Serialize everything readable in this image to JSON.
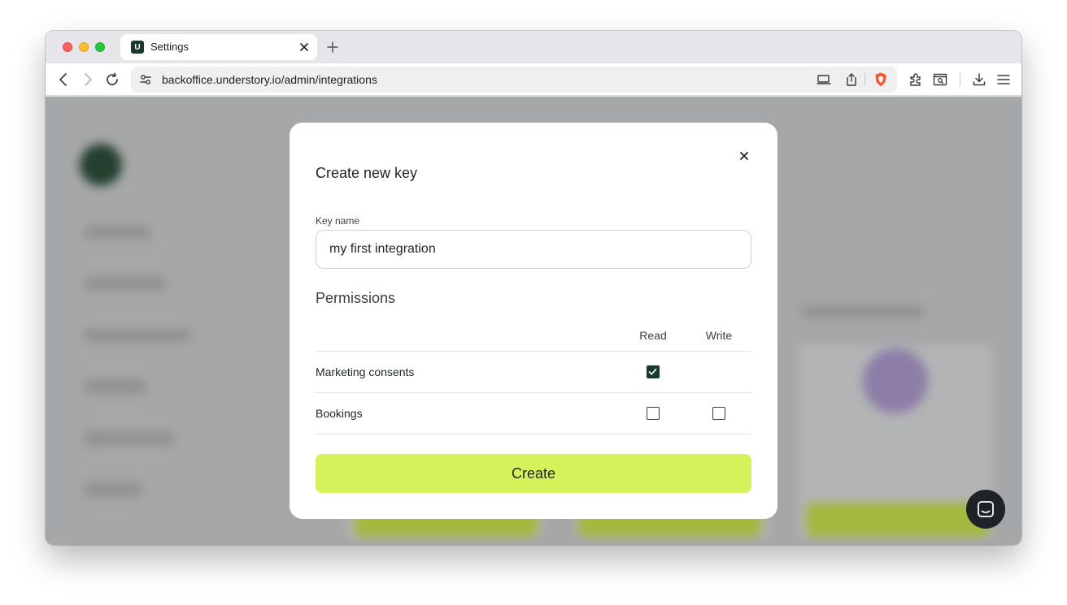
{
  "browser": {
    "tab_title": "Settings",
    "tab_favicon_letter": "U",
    "url": "backoffice.understory.io/admin/integrations",
    "accent_colors": {
      "brave": "#fb542b"
    }
  },
  "modal": {
    "title": "Create new key",
    "key_name_label": "Key name",
    "key_name_value": "my first integration",
    "permissions_title": "Permissions",
    "columns": {
      "read": "Read",
      "write": "Write"
    },
    "rows": [
      {
        "label": "Marketing consents",
        "read": true,
        "write": null
      },
      {
        "label": "Bookings",
        "read": false,
        "write": false
      }
    ],
    "create_label": "Create",
    "create_color": "#d4f25a",
    "check_color": "#16392b"
  }
}
